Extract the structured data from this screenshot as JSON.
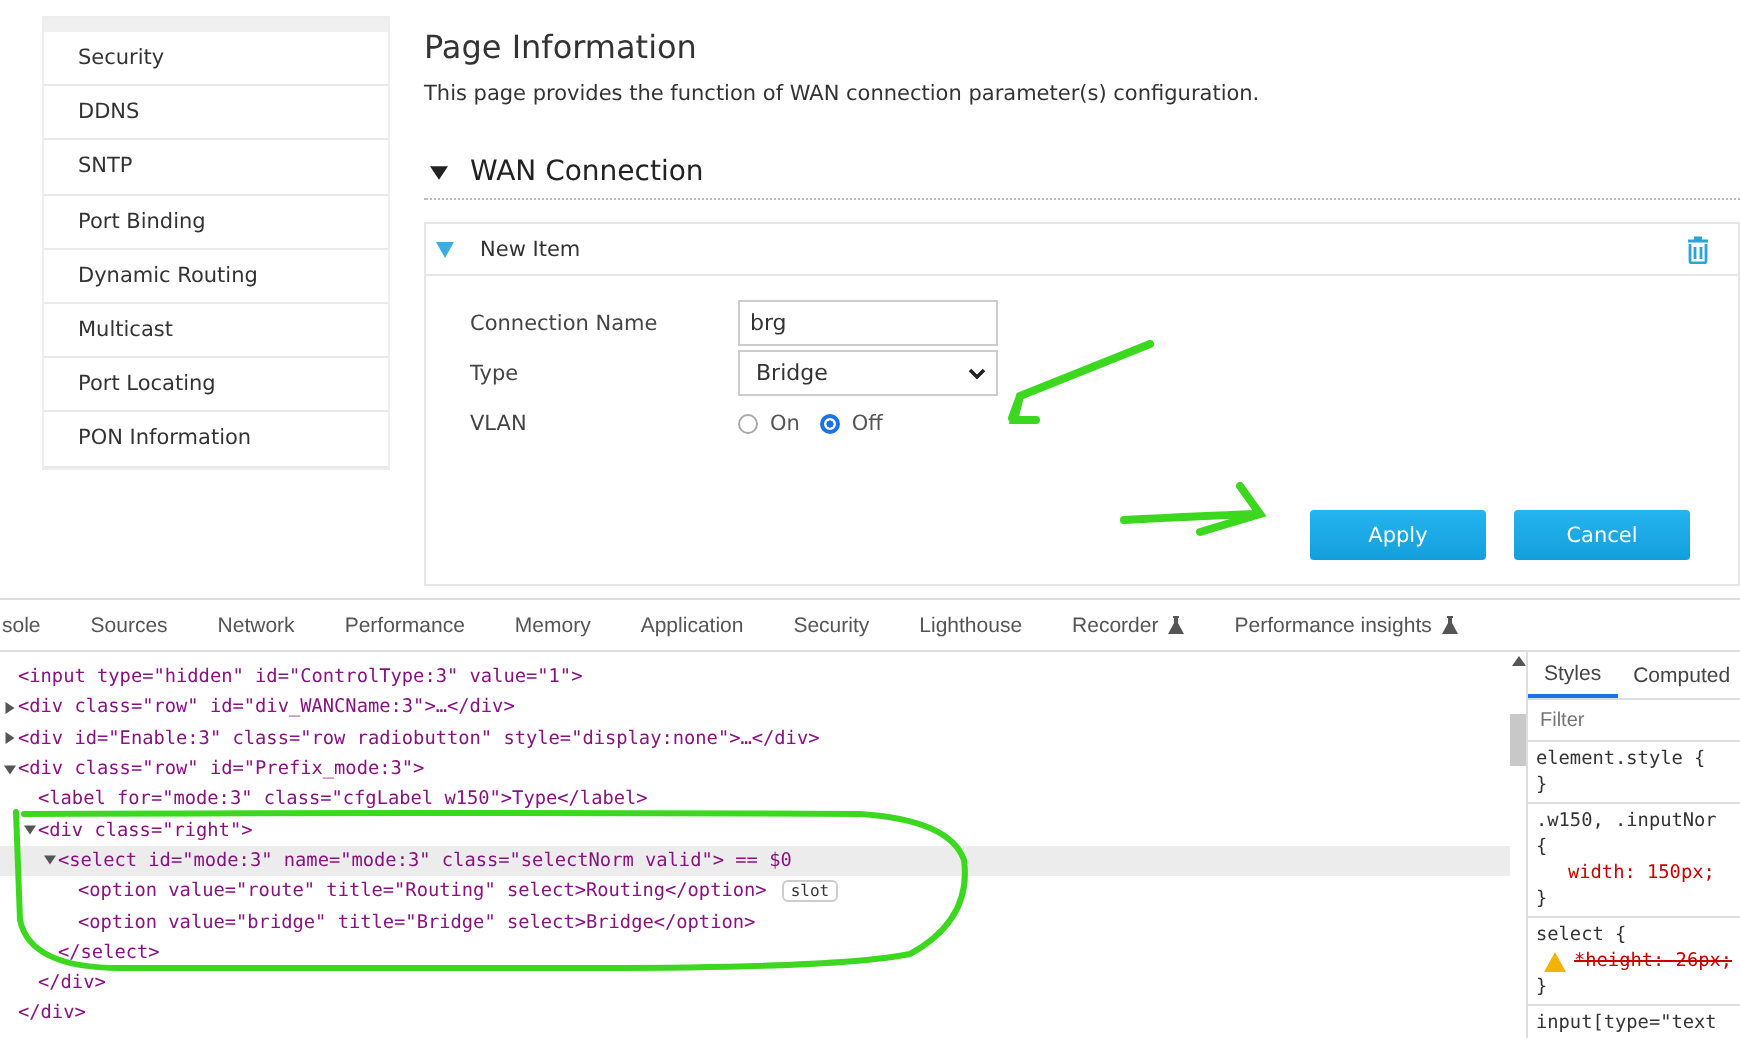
{
  "sidebar": {
    "items": [
      {
        "label": "Security"
      },
      {
        "label": "DDNS"
      },
      {
        "label": "SNTP"
      },
      {
        "label": "Port Binding"
      },
      {
        "label": "Dynamic Routing"
      },
      {
        "label": "Multicast"
      },
      {
        "label": "Port Locating"
      },
      {
        "label": "PON Information"
      }
    ]
  },
  "page": {
    "title": "Page Information",
    "description": "This page provides the function of WAN connection parameter(s) configuration."
  },
  "section": {
    "title": "WAN Connection",
    "expanded": true
  },
  "item": {
    "title": "New Item",
    "expanded": true,
    "fields": [
      {
        "kind": "text",
        "label": "Connection Name",
        "value": "brg"
      },
      {
        "kind": "select",
        "label": "Type",
        "value": "Bridge"
      },
      {
        "kind": "radio",
        "label": "VLAN",
        "options": [
          {
            "label": "On",
            "selected": false
          },
          {
            "label": "Off",
            "selected": true
          }
        ]
      }
    ]
  },
  "buttons": [
    "Apply",
    "Cancel"
  ],
  "devtools": {
    "tabs": [
      {
        "label": "sole",
        "experimental": false
      },
      {
        "label": "Sources",
        "experimental": false
      },
      {
        "label": "Network",
        "experimental": false
      },
      {
        "label": "Performance",
        "experimental": false
      },
      {
        "label": "Memory",
        "experimental": false
      },
      {
        "label": "Application",
        "experimental": false
      },
      {
        "label": "Security",
        "experimental": false
      },
      {
        "label": "Lighthouse",
        "experimental": false
      },
      {
        "label": "Recorder",
        "experimental": true
      },
      {
        "label": "Performance insights",
        "experimental": true
      }
    ],
    "nodes": [
      {
        "text": "<input type=\"hidden\" id=\"ControlType:3\" value=\"1\">",
        "selected": false
      },
      {
        "text": "<div class=\"row\" id=\"div_WANCName:3\">…</div>",
        "expanded": false,
        "selected": false
      },
      {
        "text": "<div id=\"Enable:3\" class=\"row radiobutton\" style=\"display:none\">…</div>",
        "expanded": false,
        "selected": false
      },
      {
        "text": "<div class=\"row\" id=\"Prefix_mode:3\">",
        "expanded": true,
        "selected": false,
        "close": "</div>",
        "children": [
          {
            "text": "<label for=\"mode:3\" class=\"cfgLabel w150\">Type</label>",
            "selected": false
          },
          {
            "text": "<div class=\"right\">",
            "expanded": true,
            "selected": false,
            "close": "</div>",
            "children": [
              {
                "text": "<select id=\"mode:3\" name=\"mode:3\" class=\"selectNorm valid\"> == $0",
                "expanded": true,
                "selected": true,
                "close": "</select>",
                "children": [
                  {
                    "text": "<option value=\"route\" title=\"Routing\" select>Routing</option>",
                    "selected": false,
                    "badge": "slot"
                  },
                  {
                    "text": "<option value=\"bridge\" title=\"Bridge\" select>Bridge</option>",
                    "selected": false
                  }
                ]
              }
            ]
          }
        ]
      }
    ],
    "styles": {
      "tabs": [
        {
          "label": "Styles",
          "selected": true
        },
        {
          "label": "Computed",
          "selected": false
        }
      ],
      "filter_placeholder": "Filter",
      "rules": [
        {
          "selector": "element.style {",
          "end": "}"
        },
        {
          "selector": ".w150, .inputNor",
          "open": "{",
          "declarations": [
            {
              "text": "width: 150px;",
              "overridden": false,
              "warning": false
            }
          ],
          "end": "}"
        },
        {
          "selector": "select {",
          "declarations": [
            {
              "text": "*height: 26px;",
              "overridden": true,
              "warning": true
            }
          ],
          "end": "}"
        },
        {
          "selector": "input[type=\"text"
        }
      ]
    }
  }
}
